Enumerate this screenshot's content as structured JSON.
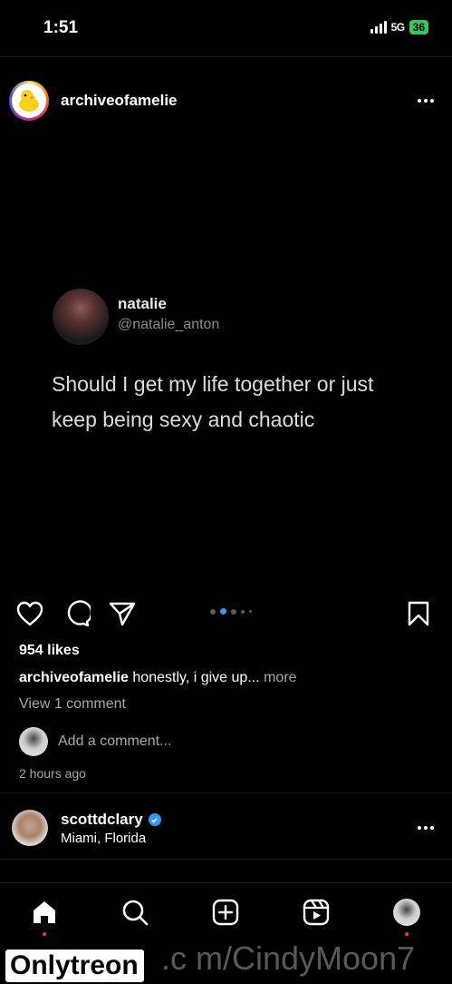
{
  "status_bar": {
    "time": "1:51",
    "network": "5G",
    "battery": "36"
  },
  "post": {
    "username": "archiveofamelie",
    "tweet": {
      "name": "natalie",
      "handle": "@natalie_anton",
      "text": "Should I get my life together or just keep being sexy and chaotic"
    },
    "likes": "954 likes",
    "caption": {
      "username": "archiveofamelie",
      "text": "honestly, i give up...",
      "more_label": "more"
    },
    "view_comments": "View 1 comment",
    "comment_placeholder": "Add a comment...",
    "timestamp": "2 hours ago",
    "carousel": {
      "count": 5,
      "active_index": 1
    }
  },
  "next_post": {
    "username": "scottdclary",
    "verified": true,
    "location": "Miami, Florida"
  },
  "bottom_nav": {
    "items": [
      "home-icon",
      "search-icon",
      "create-icon",
      "reels-icon",
      "profile-avatar"
    ]
  },
  "watermark": {
    "badge": "Onlytreon",
    "url_text": ".c m/CindyMoon7"
  },
  "colors": {
    "background": "#000000",
    "accent": "#3897f0",
    "notification": "#ff3040",
    "battery": "#34c759"
  }
}
